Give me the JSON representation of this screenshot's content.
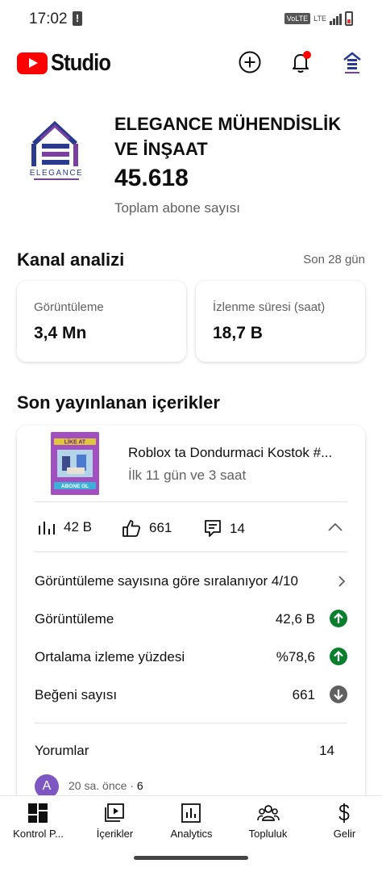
{
  "status_bar": {
    "time": "17:02",
    "volte": "VoLTE",
    "network": "LTE"
  },
  "header": {
    "logo_text": "Studio",
    "icons": [
      "create-icon",
      "notifications-icon",
      "channel-avatar-icon"
    ]
  },
  "channel": {
    "name": "ELEGANCE MÜHENDİSLİK VE İNŞAAT",
    "logo_text": "ELEGANCE",
    "subscribers": "45.618",
    "subscribers_label": "Toplam abone sayısı"
  },
  "analytics": {
    "title": "Kanal analizi",
    "period": "Son 28 gün",
    "cards": [
      {
        "label": "Görüntüleme",
        "value": "3,4 Mn"
      },
      {
        "label": "İzlenme süresi (saat)",
        "value": "18,7 B"
      }
    ]
  },
  "recent": {
    "title": "Son yayınlanan içerikler",
    "video": {
      "title": "Roblox ta Dondurmaci Kostok #...",
      "subtitle": "İlk 11 gün ve 3 saat",
      "thumb_top_text": "LİKE AT",
      "thumb_bottom_text": "ABONE OL",
      "views": "42 B",
      "likes": "661",
      "comments": "14"
    },
    "rank_row": "Görüntüleme sayısına göre sıralanıyor 4/10",
    "rows": [
      {
        "label": "Görüntüleme",
        "value": "42,6 B",
        "trend": "up"
      },
      {
        "label": "Ortalama izleme yüzdesi",
        "value": "%78,6",
        "trend": "up"
      },
      {
        "label": "Beğeni sayısı",
        "value": "661",
        "trend": "down"
      }
    ],
    "comments_label": "Yorumlar",
    "comments_count": "14",
    "comment": {
      "avatar_letter": "A",
      "time": "20 sa. önce · ",
      "number": "6"
    }
  },
  "bottom_nav": [
    {
      "label": "Kontrol P...",
      "icon": "dashboard-icon"
    },
    {
      "label": "İçerikler",
      "icon": "content-icon"
    },
    {
      "label": "Analytics",
      "icon": "analytics-icon"
    },
    {
      "label": "Topluluk",
      "icon": "community-icon"
    },
    {
      "label": "Gelir",
      "icon": "earn-icon"
    }
  ],
  "colors": {
    "brand_red": "#ff0000",
    "trend_up": "#0a7f2e",
    "trend_down": "#606060",
    "logo_blue": "#2a3b8f",
    "logo_purple": "#7b3fa0"
  }
}
